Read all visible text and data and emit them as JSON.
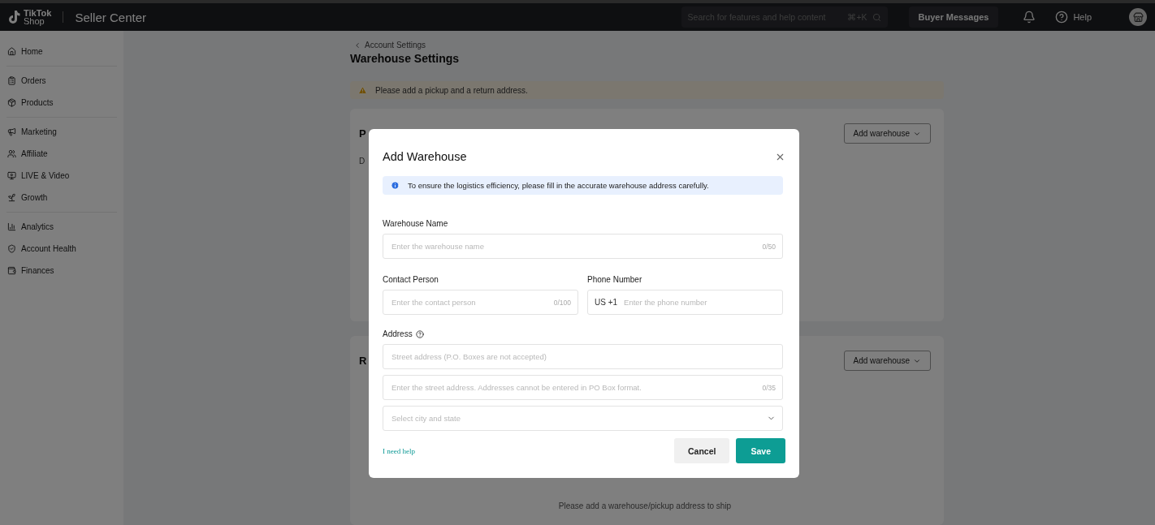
{
  "topbar": {
    "logo_top": "TikTok",
    "logo_bottom": "Shop",
    "title": "Seller Center",
    "search": {
      "placeholder": "Search for features and help content",
      "shortcut": "⌘+K"
    },
    "buyer_messages": "Buyer Messages",
    "help": "Help"
  },
  "sidebar": {
    "groups": [
      [
        {
          "label": "Home"
        }
      ],
      [
        {
          "label": "Orders"
        },
        {
          "label": "Products"
        }
      ],
      [
        {
          "label": "Marketing"
        },
        {
          "label": "Affiliate"
        },
        {
          "label": "LIVE & Video"
        },
        {
          "label": "Growth"
        }
      ],
      [
        {
          "label": "Analytics"
        },
        {
          "label": "Account Health"
        },
        {
          "label": "Finances"
        }
      ]
    ]
  },
  "page": {
    "breadcrumb": "Account Settings",
    "title": "Warehouse Settings",
    "warning": "Please add a pickup and a return address.",
    "cards": [
      {
        "title": "P",
        "text": "D",
        "button": "Add warehouse"
      },
      {
        "title": "R",
        "button": "Add warehouse",
        "empty": "Please add a warehouse/pickup address to ship"
      }
    ]
  },
  "dialog": {
    "title": "Add Warehouse",
    "info": "To ensure the logistics efficiency, please fill in the accurate warehouse address carefully.",
    "warehouse_name": {
      "label": "Warehouse Name",
      "placeholder": "Enter the warehouse name",
      "counter": "0/50"
    },
    "contact_person": {
      "label": "Contact Person",
      "placeholder": "Enter the contact person",
      "counter": "0/100"
    },
    "phone_number": {
      "label": "Phone Number",
      "prefix": "US +1",
      "placeholder": "Enter the phone number"
    },
    "address": {
      "label": "Address",
      "street": {
        "placeholder": "Street address (P.O. Boxes are not accepted)"
      },
      "street2": {
        "placeholder": "Enter the street address. Addresses cannot be entered in PO Box format.",
        "counter": "0/35"
      },
      "city": {
        "placeholder": "Select city and state"
      }
    },
    "help_link": "I need help",
    "cancel": "Cancel",
    "save": "Save"
  }
}
